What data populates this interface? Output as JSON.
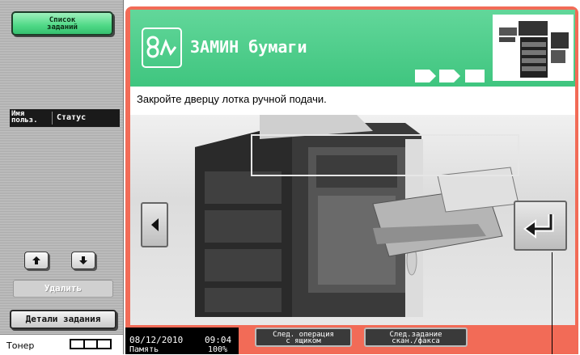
{
  "left_panel": {
    "job_list_label": "Список\nзаданий",
    "header_user": "Имя\nпольз.",
    "header_status": "Статус",
    "delete_label": "Удалить",
    "job_details_label": "Детали задания",
    "toner_label": "Тонер",
    "toner_level_segments": 3
  },
  "main": {
    "title": "ЗАМИН бумаги",
    "instruction": "Закройте дверцу лотка ручной подачи.",
    "icons": {
      "title": "jam-icon",
      "back": "back-arrow-icon",
      "return": "return-arrow-icon",
      "machine": "printer-thumbnail-icon"
    }
  },
  "status_bar": {
    "date": "08/12/2010",
    "time": "09:04",
    "memory_label": "Память",
    "memory_value": "100%",
    "next_operation_label": "След. операция\nс ящиком",
    "next_scan_label": "След.задание\nскан./факса"
  },
  "colors": {
    "frame": "#f26b57",
    "title_bar": "#4fcd8a",
    "job_list_button": "#4fd986"
  }
}
